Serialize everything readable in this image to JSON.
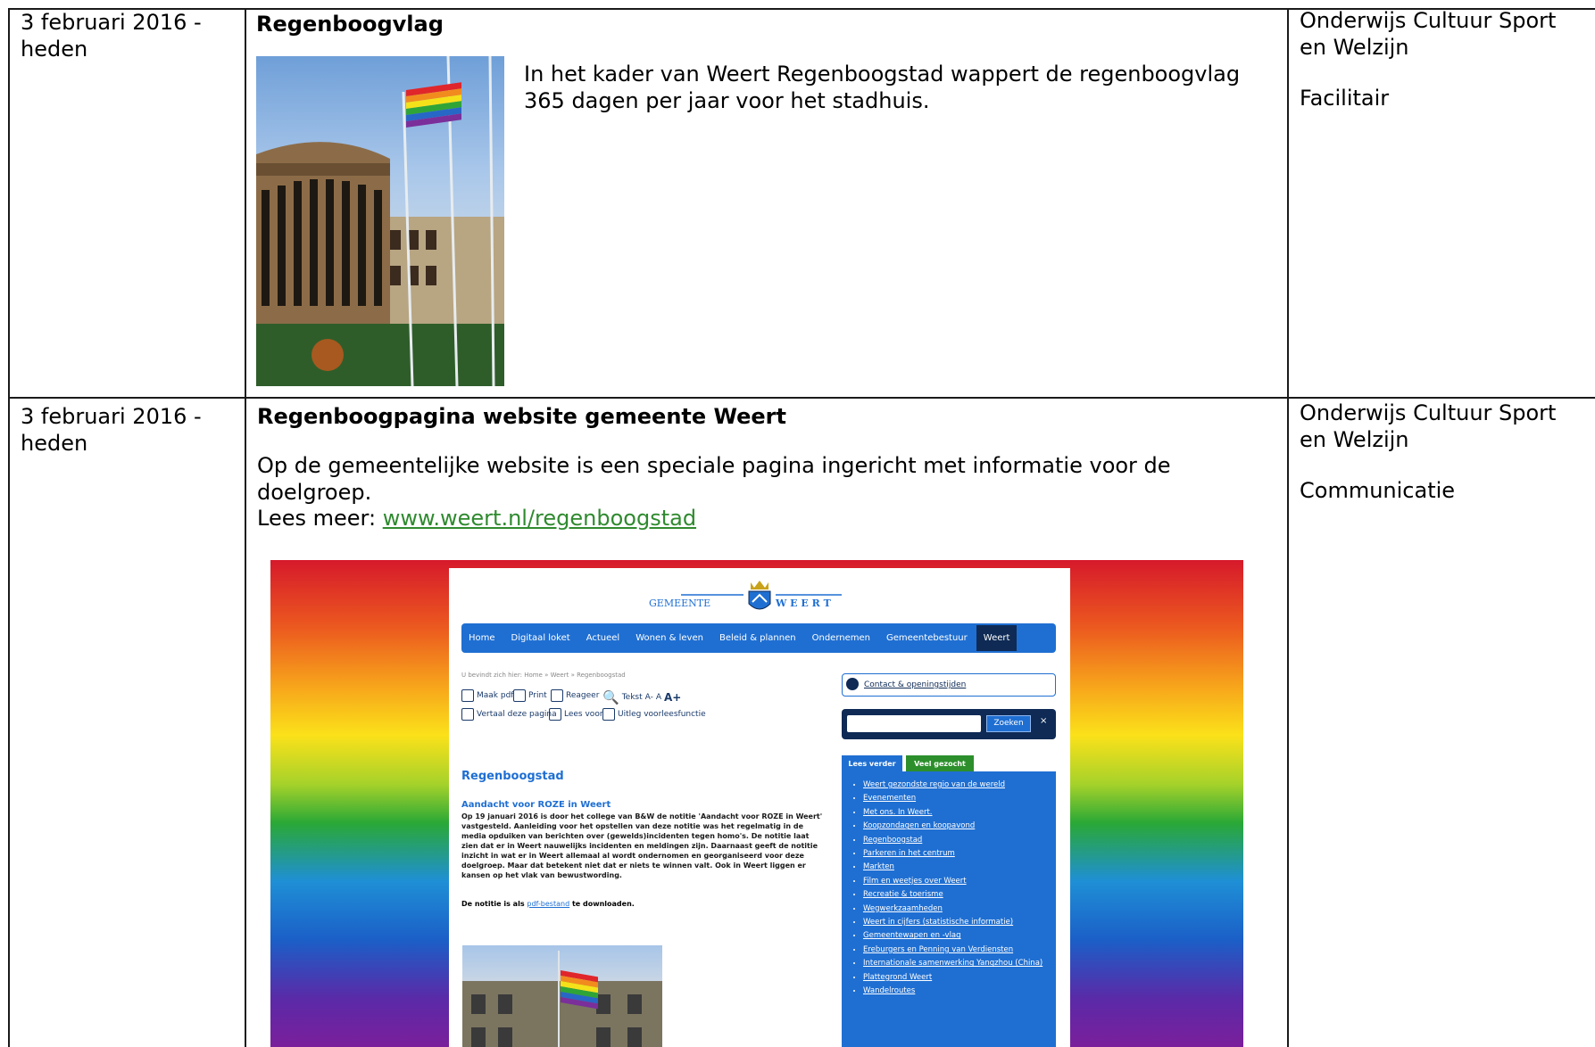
{
  "rows": [
    {
      "date": "3 februari 2016 -\nheden",
      "title": "Regenboogvlag",
      "text": "In het kader van Weert Regenboogstad wappert de regenboogvlag 365 dagen per jaar voor het stadhuis.",
      "dept_line1": "Onderwijs Cultuur Sport en Welzijn",
      "dept_line2": "Facilitair"
    },
    {
      "date": "3 februari 2016 -\nheden",
      "title": "Regenboogpagina website gemeente Weert",
      "text": "Op de gemeentelijke website is een speciale pagina ingericht met informatie voor de doelgroep.",
      "read_more_label": "Lees meer:",
      "link": "www.weert.nl/regenboogstad",
      "dept_line1": "Onderwijs Cultuur Sport en Welzijn",
      "dept_line2": "Communicatie"
    }
  ],
  "website": {
    "logo_left": "GEMEENTE",
    "logo_right": "W E E R T",
    "nav": [
      "Home",
      "Digitaal loket",
      "Actueel",
      "Wonen & leven",
      "Beleid & plannen",
      "Ondernemen",
      "Gemeentebestuur",
      "Weert"
    ],
    "breadcrumb": "U bevindt zich hier: Home » Weert » Regenboogstad",
    "tools": [
      "Maak pdf",
      "Print",
      "Reageer",
      "Tekst",
      "A-",
      "A",
      "A+",
      "Vertaal deze pagina",
      "Lees voor",
      "Uitleg voorleesfunctie"
    ],
    "contact": "Contact & openingstijden",
    "search_button": "Zoeken",
    "tab_read": "Lees verder",
    "tab_popular": "Veel gezocht",
    "heading": "Regenboogstad",
    "subheading": "Aandacht voor ROZE in Weert",
    "body": "Op 19 januari 2016 is door het college van B&W de notitie 'Aandacht voor ROZE in Weert' vastgesteld. Aanleiding voor het opstellen van deze notitie was het regelmatig in de media opduiken van berichten over (gewelds)incidenten tegen homo's. De notitie laat zien dat er in Weert nauwelijks incidenten en meldingen zijn. Daarnaast geeft de notitie inzicht in wat er in Weert allemaal al wordt ondernomen en georganiseerd voor deze doelgroep. Maar dat betekent niet dat er niets te winnen valt. Ook in Weert liggen er kansen op het vlak van bewustwording.",
    "pdf_note_prefix": "De notitie is als",
    "pdf_link": "pdf-bestand",
    "pdf_note_suffix": "te downloaden.",
    "links": [
      "Weert gezondste regio van de wereld",
      "Evenementen",
      "Met ons. In Weert.",
      "Koopzondagen en koopavond",
      "Regenboogstad",
      "Parkeren in het centrum",
      "Markten",
      "Film en weetjes over Weert",
      "Recreatie & toerisme",
      "Wegwerkzaamheden",
      "Weert in cijfers (statistische informatie)",
      "Gemeentewapen en -vlag",
      "Ereburgers en Penning van Verdiensten",
      "Internationale samenwerking Yangzhou (China)",
      "Plattegrond Weert",
      "Wandelroutes"
    ]
  }
}
